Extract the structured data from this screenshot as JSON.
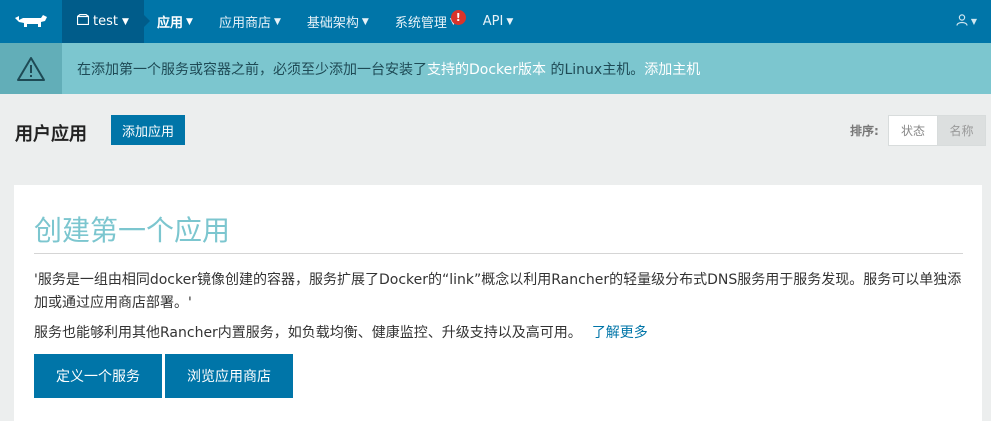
{
  "nav": {
    "env_label": "test",
    "items": [
      {
        "label": "应用"
      },
      {
        "label": "应用商店"
      },
      {
        "label": "基础架构"
      },
      {
        "label": "系统管理"
      },
      {
        "label": "API"
      }
    ],
    "alert_badge": "!"
  },
  "warning": {
    "text_before": "在添加第一个服务或容器之前，必须至少添加一台安装了",
    "link_docker": "支持的Docker版本",
    "text_after": " 的Linux主机。",
    "link_add_host": "添加主机"
  },
  "header": {
    "title": "用户应用",
    "add_button": "添加应用",
    "sort_label": "排序:",
    "sort_options": [
      "状态",
      "名称"
    ],
    "sort_selected": "名称"
  },
  "card": {
    "title": "创建第一个应用",
    "description": "'服务是一组由相同docker镜像创建的容器，服务扩展了Docker的“link”概念以利用Rancher的轻量级分布式DNS服务用于服务发现。服务可以单独添加或通过应用商店部署。'",
    "description2": "服务也能够利用其他Rancher内置服务，如负载均衡、健康监控、升级支持以及高可用。",
    "learn_more": "了解更多",
    "button_define_service": "定义一个服务",
    "button_browse_catalog": "浏览应用商店"
  },
  "colors": {
    "nav_bg": "#0075a8",
    "env_bg": "#005c8a",
    "warning_bg": "#7cc6cf",
    "title_teal": "#7cc6cf",
    "badge_red": "#d9342b"
  },
  "icons": [
    "rancher-logo-icon",
    "environment-icon",
    "chevron-down-icon",
    "user-icon",
    "warning-triangle-icon"
  ]
}
